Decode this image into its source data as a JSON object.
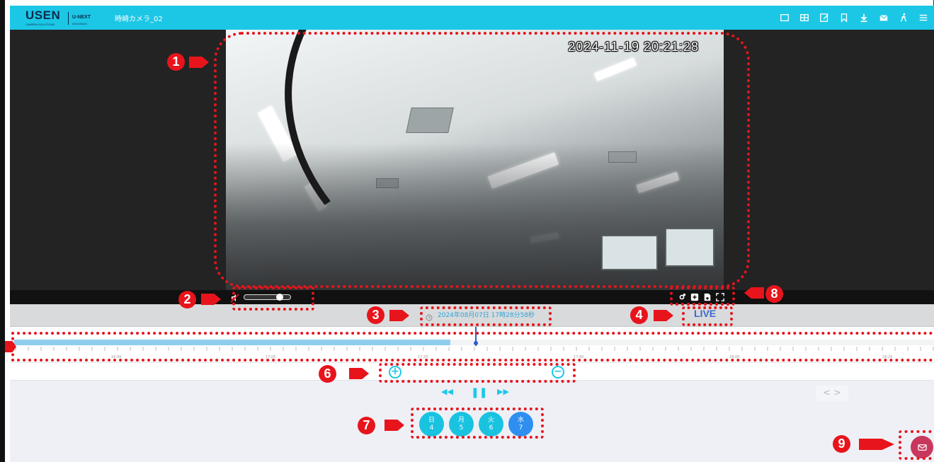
{
  "header": {
    "brand": "USEN",
    "brand_sub": "CAMERA SOLUTIONS",
    "partner": "U-NEXT",
    "partner_sub": "HOLDINGS",
    "camera_name": "時崎カメラ_02",
    "icons": [
      "single-view-icon",
      "grid-view-icon",
      "edit-icon",
      "bookmark-icon",
      "download-icon",
      "mail-icon",
      "walking-person-icon",
      "menu-icon"
    ]
  },
  "video": {
    "timestamp": "2024-11-19 20:21:28"
  },
  "player": {
    "volume_level": 0.75,
    "tool_icons": [
      "settings-icon",
      "add-icon",
      "snapshot-icon",
      "fullscreen-icon"
    ]
  },
  "info": {
    "recording_time": "2024年08月07日 17時28分58秒",
    "live_label": "LIVE"
  },
  "timeline": {
    "tick_labels": [
      "16:40",
      "17:00",
      "17:20",
      "17:40",
      "18:00",
      "18:20"
    ],
    "played_fraction": 0.47
  },
  "zoom": {
    "zoom_in": "+",
    "zoom_out": "−"
  },
  "playback": {
    "rewind": "◀◀",
    "pause": "❚❚",
    "forward": "▶▶",
    "nav": "< >"
  },
  "days": [
    {
      "weekday": "日",
      "date": "4",
      "selected": false
    },
    {
      "weekday": "月",
      "date": "5",
      "selected": false
    },
    {
      "weekday": "火",
      "date": "6",
      "selected": false
    },
    {
      "weekday": "水",
      "date": "7",
      "selected": true
    }
  ],
  "annotations": [
    "1",
    "2",
    "3",
    "4",
    "5",
    "6",
    "7",
    "8",
    "9"
  ],
  "colors": {
    "accent": "#1cc7e6",
    "annotation": "#e8141c",
    "live": "#3d6ad1",
    "mail": "#c8385e"
  }
}
